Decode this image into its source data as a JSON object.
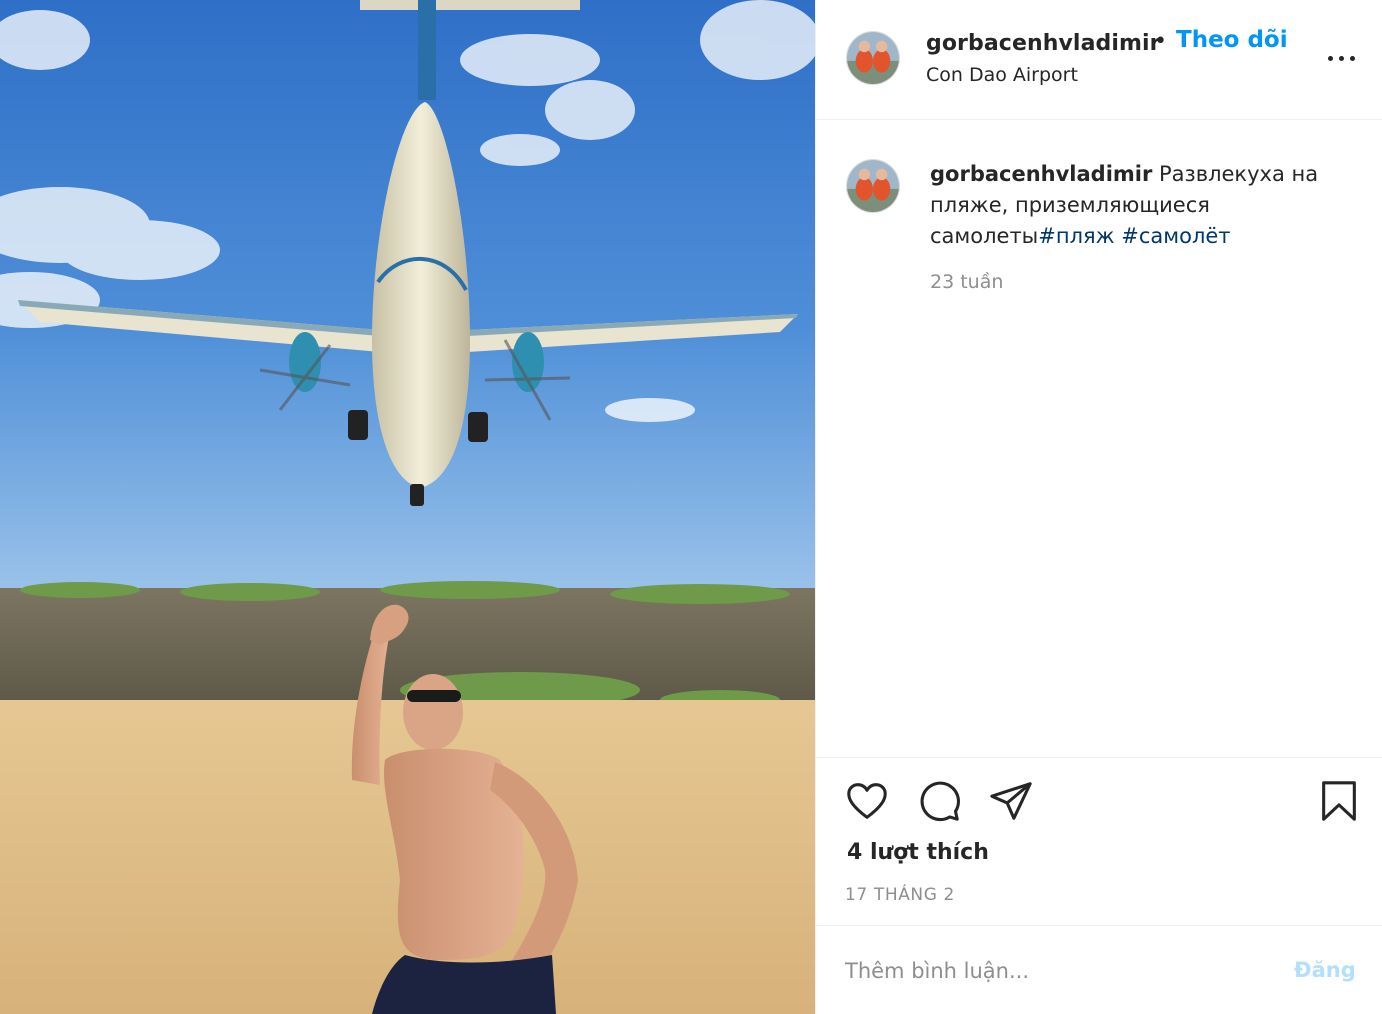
{
  "post": {
    "photo_description_icon": "photo-airplane-beach"
  },
  "header": {
    "username": "gorbacenhvladimir",
    "separator": "•",
    "follow_label": "Theo dõi",
    "location": "Con Dao Airport",
    "more_icon": "more-horizontal-icon"
  },
  "caption": {
    "username": "gorbacenhvladimir",
    "text": " Развлекуха на пляже, приземляющиеся самолеты",
    "hashtags": [
      "#пляж",
      "#самолёт"
    ],
    "time_ago": "23 tuần"
  },
  "actions": {
    "like_icon": "heart-icon",
    "comment_icon": "comment-icon",
    "share_icon": "share-icon",
    "save_icon": "bookmark-icon",
    "likes_text": "4 lượt thích",
    "date": "17 THÁNG 2"
  },
  "comment": {
    "placeholder": "Thêm bình luận...",
    "post_label": "Đăng"
  },
  "colors": {
    "accent": "#0095f6",
    "hashtag": "#00376b",
    "muted": "#8e8e8e",
    "post_disabled": "#b2dffc"
  }
}
